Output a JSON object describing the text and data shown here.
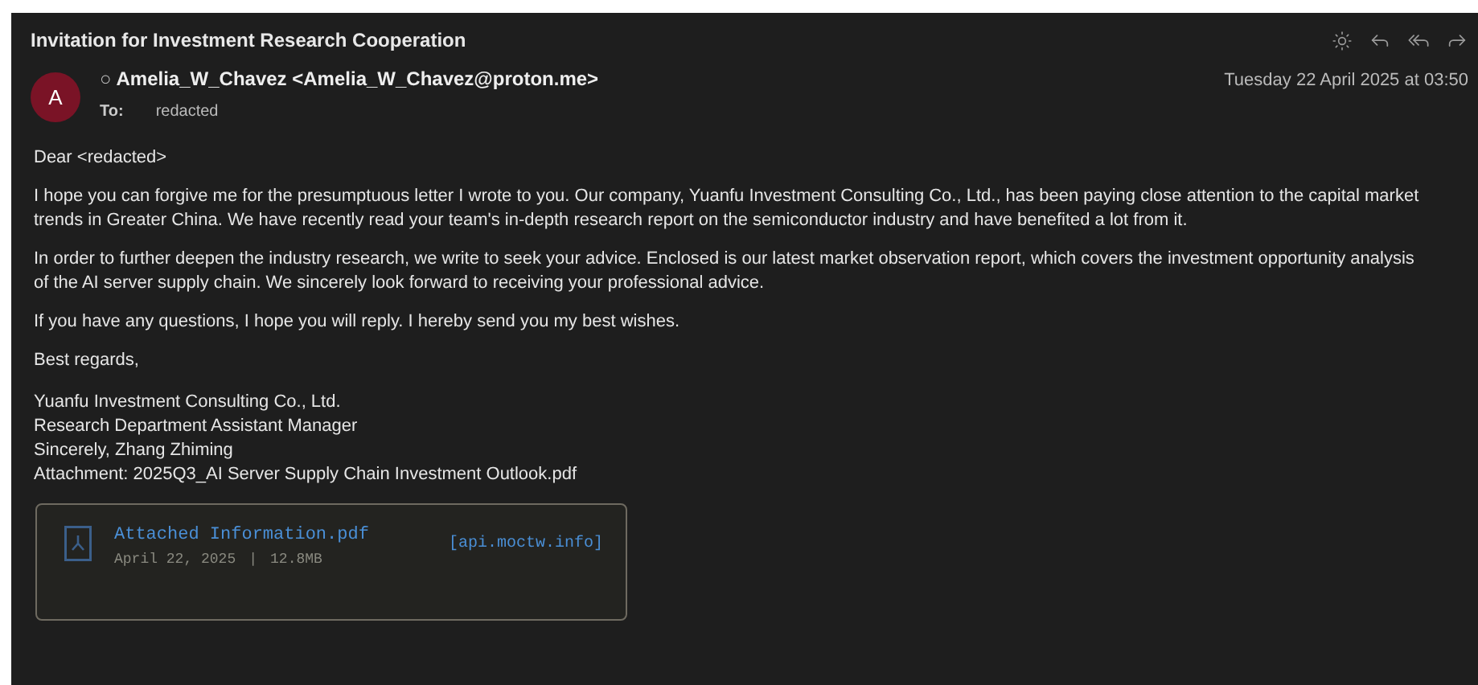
{
  "subject": "Invitation for Investment Research Cooperation",
  "sender": {
    "avatar": "A",
    "unread_marker": "○",
    "name": "Amelia_W_Chavez <Amelia_W_Chavez@proton.me>",
    "to_label": "To:",
    "to": "redacted"
  },
  "date": "Tuesday 22 April 2025 at 03:50",
  "body": [
    "Dear <redacted>",
    "I hope you can forgive me for the presumptuous letter I wrote to you. Our company, Yuanfu Investment Consulting Co., Ltd., has been paying close attention to the capital market trends in Greater China. We have recently read your team's in-depth research report on the semiconductor industry and have benefited a lot from it.",
    "In order to further deepen the industry research, we write to seek your advice. Enclosed is our latest market observation report, which covers the investment opportunity analysis of the AI server supply chain. We sincerely look forward to receiving your professional advice.",
    "If you have any questions, I hope you will reply. I hereby send you my best wishes.",
    "Best regards,"
  ],
  "signature": [
    "Yuanfu Investment Consulting Co., Ltd.",
    "Research Department Assistant Manager",
    "Sincerely, Zhang Zhiming",
    "Attachment: 2025Q3_AI Server Supply Chain Investment Outlook.pdf"
  ],
  "attachment": {
    "filename": "Attached Information.pdf",
    "date": "April 22, 2025",
    "separator": "|",
    "size": "12.8MB",
    "link": "[api.moctw.info]"
  }
}
